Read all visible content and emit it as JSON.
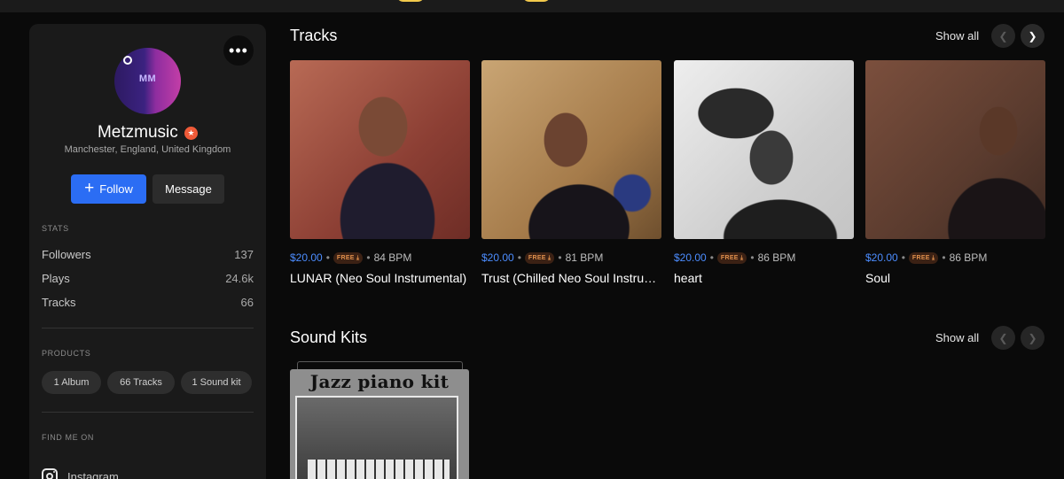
{
  "profile": {
    "name": "Metzmusic",
    "location": "Manchester, England, United Kingdom",
    "avatar_initials": "MM",
    "more_label": "•••",
    "follow_label": "Follow",
    "message_label": "Message"
  },
  "stats": {
    "label": "STATS",
    "rows": [
      {
        "label": "Followers",
        "value": "137"
      },
      {
        "label": "Plays",
        "value": "24.6k"
      },
      {
        "label": "Tracks",
        "value": "66"
      }
    ]
  },
  "products": {
    "label": "PRODUCTS",
    "chips": [
      "1 Album",
      "66 Tracks",
      "1 Sound kit"
    ]
  },
  "find_me": {
    "label": "FIND ME ON",
    "links": [
      "Instagram"
    ]
  },
  "tracks_section": {
    "title": "Tracks",
    "show_all": "Show all",
    "items": [
      {
        "price": "$20.00",
        "badge": "FREE ⤓",
        "bpm": "84 BPM",
        "title": "LUNAR (Neo Soul Instrumental)"
      },
      {
        "price": "$20.00",
        "badge": "FREE ⤓",
        "bpm": "81 BPM",
        "title": "Trust (Chilled Neo Soul Instrumental)"
      },
      {
        "price": "$20.00",
        "badge": "FREE ⤓",
        "bpm": "86 BPM",
        "title": "heart"
      },
      {
        "price": "$20.00",
        "badge": "FREE ⤓",
        "bpm": "86 BPM",
        "title": "Soul"
      }
    ]
  },
  "soundkits_section": {
    "title": "Sound Kits",
    "show_all": "Show all",
    "items": [
      {
        "cover_text": "Jazz piano kit"
      }
    ]
  },
  "colors": {
    "accent_blue": "#2b6df4",
    "price_blue": "#4c8dff",
    "verified_orange": "#ef5a38"
  }
}
